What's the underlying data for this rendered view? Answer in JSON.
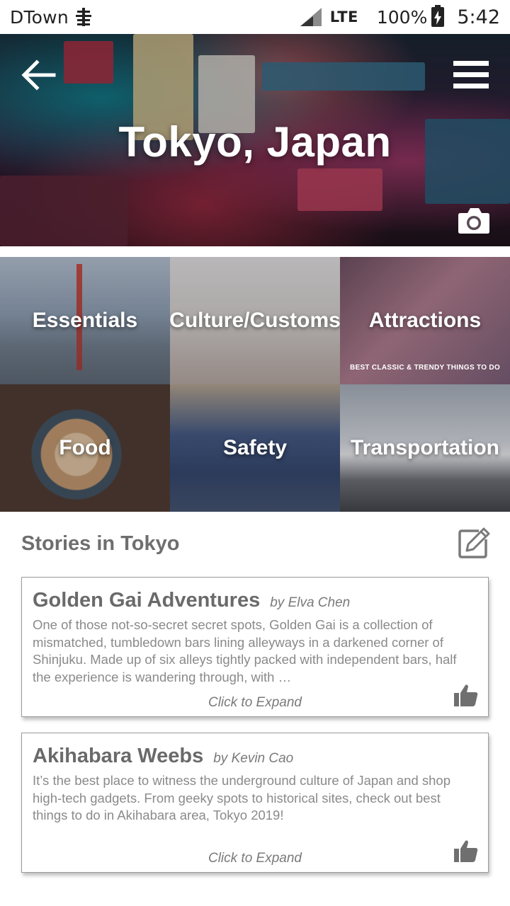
{
  "status_bar": {
    "carrier": "DTown",
    "network": "LTE",
    "battery": "100%",
    "time": "5:42"
  },
  "hero": {
    "title": "Tokyo, Japan",
    "back_icon": "arrow-left-icon",
    "menu_icon": "hamburger-menu-icon",
    "camera_icon": "camera-icon"
  },
  "categories": [
    {
      "label": "Essentials"
    },
    {
      "label": "Culture/Customs"
    },
    {
      "label": "Attractions",
      "subtitle": "BEST CLASSIC & TRENDY THINGS TO DO"
    },
    {
      "label": "Food"
    },
    {
      "label": "Safety"
    },
    {
      "label": "Transportation"
    }
  ],
  "stories": {
    "header": "Stories in Tokyo",
    "edit_icon": "edit-icon",
    "items": [
      {
        "title": "Golden Gai Adventures",
        "author": "by Elva Chen",
        "excerpt": "One of those not-so-secret secret spots, Golden Gai is a collection of mismatched, tumbledown bars lining alleyways in a darkened corner of Shinjuku. Made up of six alleys tightly packed with independent bars, half the experience is wandering through, with …",
        "expand": "Click to Expand"
      },
      {
        "title": "Akihabara Weebs",
        "author": "by Kevin Cao",
        "excerpt": "It’s the best place to witness the underground culture of Japan and shop high-tech gadgets. From geeky spots to historical sites, check out best things to do in Akihabara area, Tokyo 2019!",
        "expand": "Click to Expand"
      }
    ]
  }
}
